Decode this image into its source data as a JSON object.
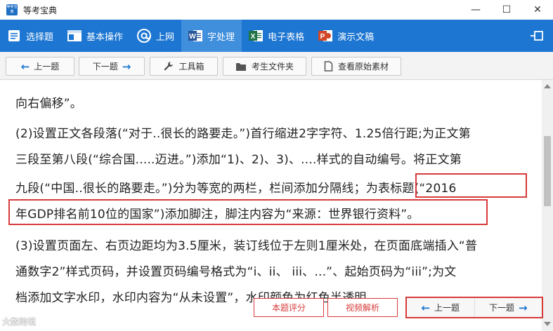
{
  "window": {
    "app_icon_text": "等考宝典",
    "title": "等考宝典",
    "minimize_glyph": "—",
    "maximize_glyph": "☐",
    "close_glyph": "✕"
  },
  "main_tabs": [
    {
      "label": "选择题",
      "icon": "choice-icon"
    },
    {
      "label": "基本操作",
      "icon": "window-icon"
    },
    {
      "label": "上网",
      "icon": "at-icon"
    },
    {
      "label": "字处理",
      "icon": "word-icon"
    },
    {
      "label": "电子表格",
      "icon": "excel-icon"
    },
    {
      "label": "演示文稿",
      "icon": "ppt-icon"
    }
  ],
  "sub_toolbar": {
    "prev": "上一题",
    "next": "下一题",
    "toolbox": "工具箱",
    "exam_folder": "考生文件夹",
    "view_source": "查看原始素材"
  },
  "content": {
    "lines": [
      "向右偏移”。",
      "(2)设置正文各段落(“对于..很长的路要走。”)首行缩进2字字符、1.25倍行距;为正文第",
      "三段至第八段(“综合国.....迈进。”)添加“1)、2)、3)、....样式的自动编号。将正文第",
      "九段(“中国..很长的路要走。”)分为等宽的两栏，栏间添加分隔线；为表标题(“2016",
      "年GDP排名前10位的国家”)添加脚注，脚注内容为“来源：世界银行资料”。",
      "(3)设置页面左、右页边距均为3.5厘米，装订线位于左则1厘米处，在页面底端插入“普",
      "通数字2”样式页码，并设置页码编号格式为“i、ii、 iii、...”、起始页码为“iii”;为文",
      "档添加文字水印，水印内容为“从未设置”，水印颜色为红色半透明。"
    ]
  },
  "bottom_bar": {
    "score": "本题评分",
    "video": "视频解析",
    "prev": "上一题",
    "next": "下一题"
  },
  "watermark": "大数跨境",
  "colors": {
    "toolbar_blue": "#1c76d2",
    "highlight_red": "#d83a3a"
  }
}
